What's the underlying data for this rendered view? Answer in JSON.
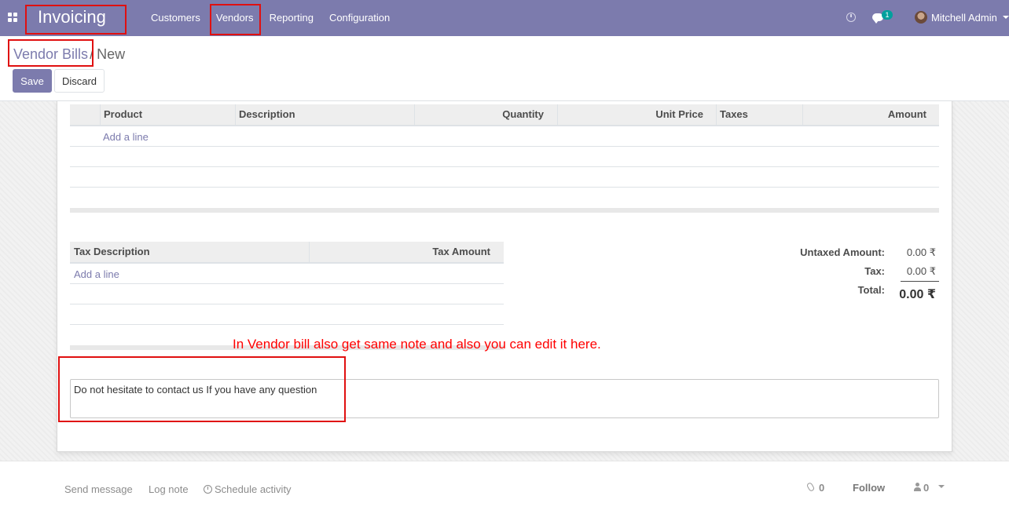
{
  "navbar": {
    "app_name": "Invoicing",
    "menu": [
      "Customers",
      "Vendors",
      "Reporting",
      "Configuration"
    ],
    "chat_badge": "1",
    "user_name": "Mitchell Admin"
  },
  "breadcrumb": {
    "parent": "Vendor Bills",
    "separator": "/",
    "current": "New"
  },
  "buttons": {
    "save": "Save",
    "discard": "Discard"
  },
  "invoice_lines": {
    "columns": [
      "Product",
      "Description",
      "Quantity",
      "Unit Price",
      "Taxes",
      "Amount"
    ],
    "add_line": "Add a line"
  },
  "tax_lines": {
    "columns": [
      "Tax Description",
      "Tax Amount"
    ],
    "add_line": "Add a line"
  },
  "totals": {
    "untaxed_label": "Untaxed Amount:",
    "untaxed_value": "0.00 ₹",
    "tax_label": "Tax:",
    "tax_value": "0.00 ₹",
    "total_label": "Total:",
    "total_value": "0.00 ₹"
  },
  "annotation": "In Vendor bill also get same note and also you can edit it here.",
  "narration": "Do not hesitate to contact us If you have any question",
  "chatter": {
    "send_message": "Send message",
    "log_note": "Log note",
    "schedule_activity": "Schedule activity",
    "attachments": "0",
    "follow": "Follow",
    "followers": "0"
  },
  "colors": {
    "brand": "#7c7bad",
    "annotation": "#ff0000",
    "highlight_box": "#e01010"
  }
}
